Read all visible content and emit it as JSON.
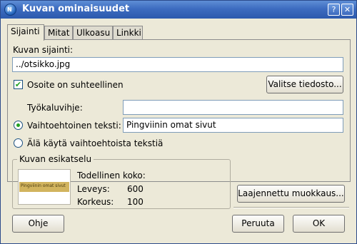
{
  "window": {
    "title": "Kuvan ominaisuudet",
    "app_icon_text": "N",
    "controls": {
      "help": "?",
      "close": "✕"
    }
  },
  "tabs": [
    {
      "label": "Sijainti",
      "active": true
    },
    {
      "label": "Mitat",
      "active": false
    },
    {
      "label": "Ulkoasu",
      "active": false
    },
    {
      "label": "Linkki",
      "active": false
    }
  ],
  "location": {
    "label": "Kuvan sijainti:",
    "value": "../otsikko.jpg",
    "relative_checkbox": {
      "label": "Osoite on suhteellinen",
      "checked": true
    },
    "choose_file_button": "Valitse tiedosto..."
  },
  "tooltip": {
    "label": "Työkaluvihje:",
    "value": ""
  },
  "alt_text": {
    "radio_label": "Vaihtoehtoinen teksti:",
    "selected": true,
    "value": "Pingviinin omat sivut"
  },
  "no_alt_text": {
    "radio_label": "Älä käytä vaihtoehtoista tekstiä",
    "selected": false
  },
  "preview": {
    "group_label": "Kuvan esikatselu",
    "banner_text": "Pingviinin omat sivut",
    "actual_size_label": "Todellinen koko:",
    "width_label": "Leveys:",
    "width_value": "600",
    "height_label": "Korkeus:",
    "height_value": "100"
  },
  "buttons": {
    "advanced_edit": "Laajennettu muokkaus...",
    "help": "Ohje",
    "cancel": "Peruuta",
    "ok": "OK"
  }
}
